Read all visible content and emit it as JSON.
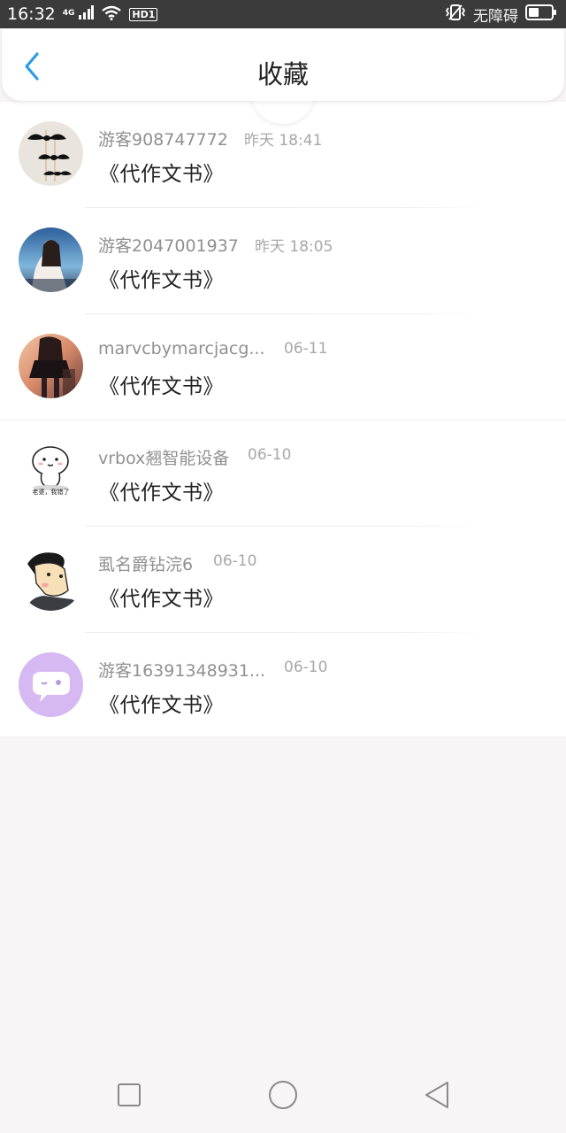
{
  "status_bar": {
    "time": "16:32",
    "network": "4G",
    "hd": "HD1",
    "accessibility": "无障碍",
    "icons": [
      "signal-icon",
      "wifi-icon",
      "vibrate-icon",
      "battery-icon"
    ]
  },
  "header": {
    "title": "收藏",
    "back_icon": "chevron-left-icon",
    "accent_color": "#2b9bea"
  },
  "items": [
    {
      "username": "游客908747772",
      "time": "昨天 18:41",
      "title": "《代作文书》",
      "avatar": "mustache-avatar"
    },
    {
      "username": "游客2047001937",
      "time": "昨天 18:05",
      "title": "《代作文书》",
      "avatar": "girl-photo-avatar"
    },
    {
      "username": "marvcbymarcjacg...",
      "time": "06-11",
      "title": "《代作文书》",
      "avatar": "anime-girl-avatar"
    },
    {
      "username": "vrbox翘智能设备",
      "time": "06-10",
      "title": "《代作文书》",
      "avatar": "cartoon-sticker-avatar",
      "avatar_caption": "老婆，我错了"
    },
    {
      "username": "虱名爵钻浣6",
      "time": "06-10",
      "title": "《代作文书》",
      "avatar": "cartoon-man-avatar"
    },
    {
      "username": "游客16391348931...",
      "time": "06-10",
      "title": "《代作文书》",
      "avatar": "default-chat-avatar"
    }
  ],
  "nav": {
    "buttons": [
      "recent-apps-button",
      "home-button",
      "back-button"
    ]
  }
}
